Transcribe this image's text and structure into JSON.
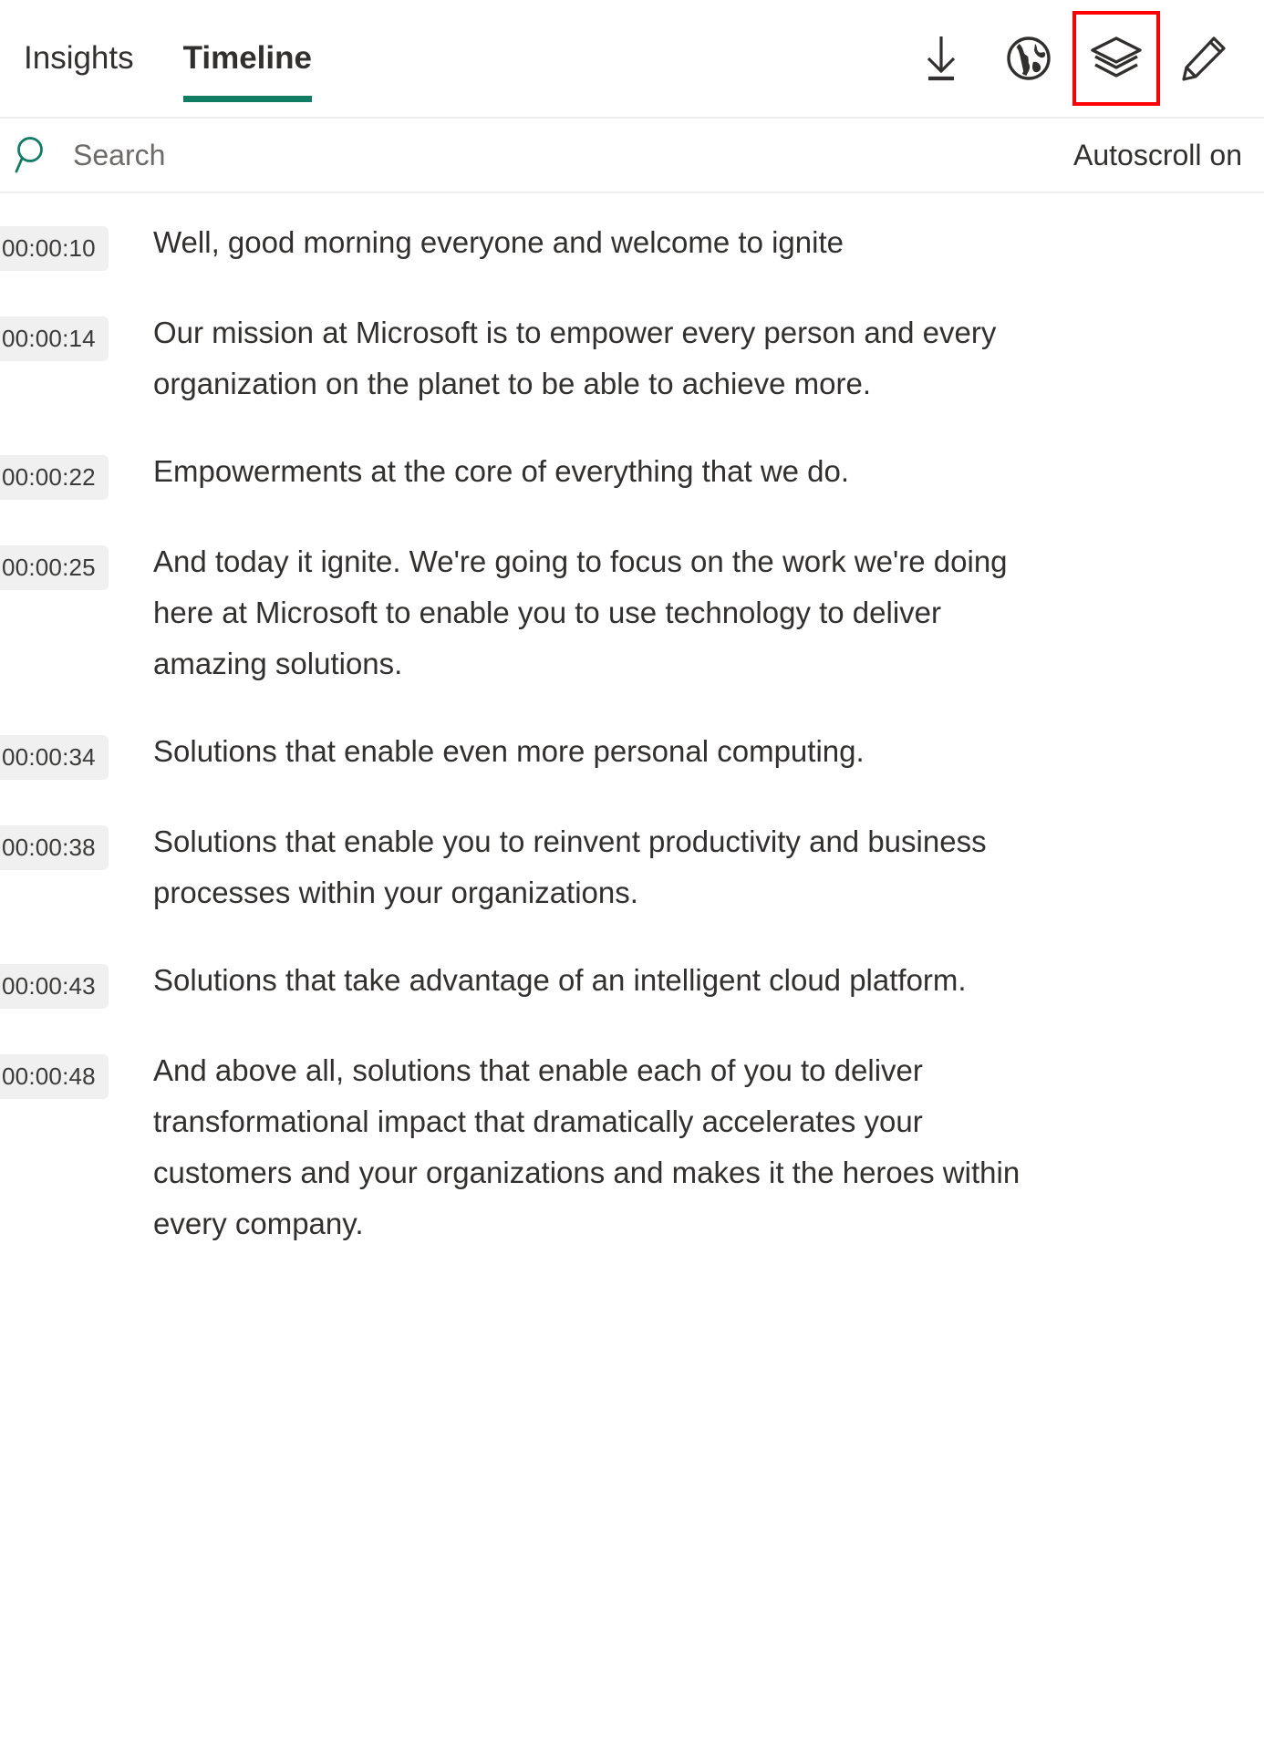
{
  "header": {
    "tabs": [
      {
        "label": "Insights",
        "active": false
      },
      {
        "label": "Timeline",
        "active": true
      }
    ],
    "actions": [
      {
        "name": "download-icon",
        "label": "Download",
        "highlighted": false
      },
      {
        "name": "globe-icon",
        "label": "Translate",
        "highlighted": false
      },
      {
        "name": "layers-icon",
        "label": "View layers",
        "highlighted": true
      },
      {
        "name": "pencil-icon",
        "label": "Edit",
        "highlighted": false
      }
    ],
    "accent_color": "#107c64",
    "highlight_color": "#ff0000"
  },
  "search": {
    "placeholder": "Search",
    "value": "",
    "icon": "search-icon",
    "icon_color": "#107c64"
  },
  "autoscroll": {
    "label": "Autoscroll on"
  },
  "transcript": {
    "rows": [
      {
        "time": "00:00:10",
        "text": "Well, good morning everyone and welcome to ignite"
      },
      {
        "time": "00:00:14",
        "text": "Our mission at Microsoft is to empower every person and every organization on the planet to be able to achieve more."
      },
      {
        "time": "00:00:22",
        "text": "Empowerments at the core of everything that we do."
      },
      {
        "time": "00:00:25",
        "text": "And today it ignite. We're going to focus on the work we're doing here at Microsoft to enable you to use technology to deliver amazing solutions."
      },
      {
        "time": "00:00:34",
        "text": "Solutions that enable even more personal computing."
      },
      {
        "time": "00:00:38",
        "text": "Solutions that enable you to reinvent productivity and business processes within your organizations."
      },
      {
        "time": "00:00:43",
        "text": "Solutions that take advantage of an intelligent cloud platform."
      },
      {
        "time": "00:00:48",
        "text": "And above all, solutions that enable each of you to deliver transformational impact that dramatically accelerates your customers and your organizations and makes it the heroes within every company."
      }
    ]
  }
}
